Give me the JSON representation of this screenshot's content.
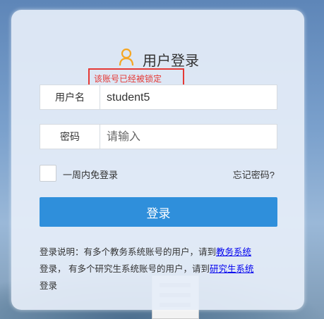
{
  "header": {
    "title": "用户登录"
  },
  "error": {
    "message": "该账号已经被锁定"
  },
  "form": {
    "username_label": "用户名",
    "username_value": "student5",
    "password_label": "密码",
    "password_placeholder": "请输入",
    "remember_label": "一周内免登录",
    "forgot_link": "忘记密码?",
    "login_button": "登录"
  },
  "note": {
    "part1": "登录说明：有多个教务系统账号的用户，请到",
    "link1": "教务系统",
    "part2": "登录， 有多个研究生系统账号的用户，请到",
    "link2": "研究生系统",
    "part3": "登录"
  },
  "colors": {
    "accent": "#2f8fdb",
    "error": "#e53935",
    "icon": "#f5a623"
  },
  "icons": {
    "user": "user-icon"
  }
}
